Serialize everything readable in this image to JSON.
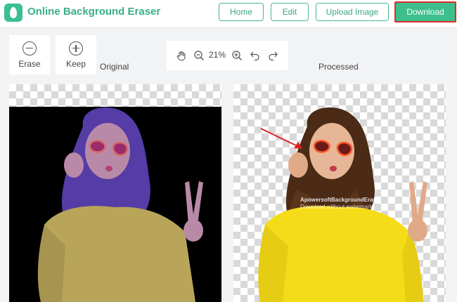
{
  "header": {
    "app_title": "Online Background Eraser",
    "nav": {
      "home": "Home",
      "edit": "Edit",
      "upload": "Upload Image",
      "download": "Download"
    }
  },
  "tools": {
    "erase_label": "Erase",
    "keep_label": "Keep"
  },
  "zoom": {
    "value": "21%",
    "icons": [
      "hand-icon",
      "zoom-out-icon",
      "zoom-in-icon",
      "undo-icon",
      "redo-icon"
    ]
  },
  "panels": {
    "original_label": "Original",
    "processed_label": "Processed",
    "watermark_line1": "ApowersoftBackgroundEraser",
    "watermark_line2": "Download without watermark"
  },
  "colors": {
    "brand": "#3bbf8f",
    "highlight_border": "#e02a2a",
    "mask_overlay": "#6a4bd8"
  }
}
